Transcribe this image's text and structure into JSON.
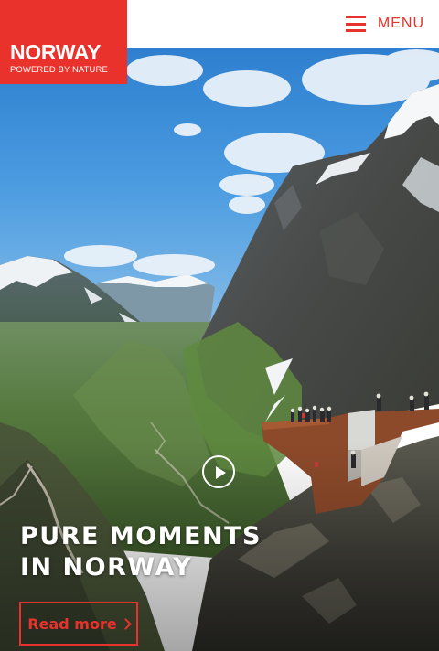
{
  "header": {
    "logo": {
      "title": "NORWAY",
      "tagline": "POWERED BY NATURE"
    },
    "menu_label": "MENU"
  },
  "hero": {
    "title_line1": "PURE MOMENTS",
    "title_line2": "IN NORWAY",
    "read_more_label": "Read more"
  },
  "colors": {
    "brand_red": "#e8322b",
    "sky": "#3a8fd8",
    "text_light": "#ffffff"
  },
  "icons": {
    "menu": "hamburger-icon",
    "play": "play-icon",
    "read_more": "chevron-right-icon"
  }
}
